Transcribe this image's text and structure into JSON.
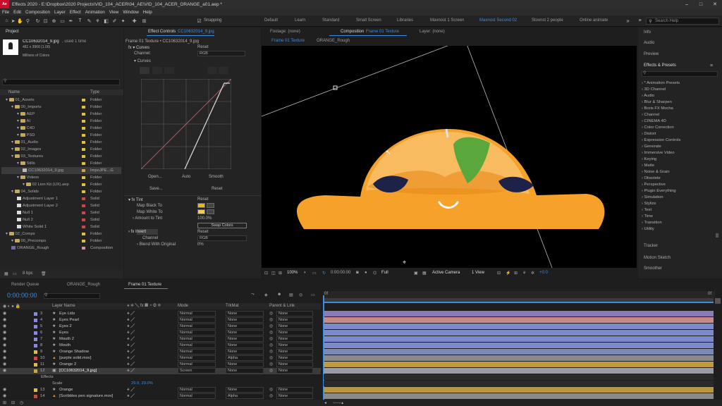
{
  "window": {
    "badge": "Ae",
    "title": "Effects 2020 - E:\\Dropbox\\2020 Projects\\VID_104_ACER\\04_AE\\VID_104_ACER_ORANGE_a01.aep *",
    "controls": [
      "–",
      "□",
      "✕"
    ]
  },
  "menu": [
    "File",
    "Edit",
    "Composition",
    "Layer",
    "Effect",
    "Animation",
    "View",
    "Window",
    "Help"
  ],
  "toolbar": {
    "snapping_label": "Snapping",
    "workspaces": [
      "Default",
      "Learn",
      "Standard",
      "Small Screen",
      "Libraries",
      "Maxnost 1 Screen",
      "Maxnost Second 02",
      "Stoxnst 2 people",
      "Online animate"
    ],
    "active_workspace_index": 6,
    "search_placeholder": "Search Help"
  },
  "project": {
    "tab": "Project",
    "item_name": "CC10632014_9.jpg",
    "item_used": ", used 1 time",
    "item_size": "481 x 3968 (1.00)",
    "item_colors": "Millions of Colors",
    "col_name": "Name",
    "col_type": "Type",
    "bpc": "8 bpc",
    "rows": [
      {
        "name": "01_Assets",
        "type": "Folder",
        "kind": "folder",
        "indent": 0,
        "swatch": "#d9c04a"
      },
      {
        "name": "00_Imports",
        "type": "Folder",
        "kind": "folder",
        "indent": 1,
        "swatch": "#d9c04a"
      },
      {
        "name": "AEP",
        "type": "Folder",
        "kind": "folder",
        "indent": 2,
        "swatch": "#d9c04a"
      },
      {
        "name": "AI",
        "type": "Folder",
        "kind": "folder",
        "indent": 2,
        "swatch": "#d9c04a"
      },
      {
        "name": "C4D",
        "type": "Folder",
        "kind": "folder",
        "indent": 2,
        "swatch": "#d9c04a"
      },
      {
        "name": "PSD",
        "type": "Folder",
        "kind": "folder",
        "indent": 2,
        "swatch": "#d9c04a"
      },
      {
        "name": "01_Audio",
        "type": "Folder",
        "kind": "folder",
        "indent": 1,
        "swatch": "#d9c04a"
      },
      {
        "name": "02_Images",
        "type": "Folder",
        "kind": "folder",
        "indent": 1,
        "swatch": "#d9c04a"
      },
      {
        "name": "03_Textures",
        "type": "Folder",
        "kind": "folder",
        "indent": 1,
        "swatch": "#d9c04a"
      },
      {
        "name": "Stills",
        "type": "Folder",
        "kind": "folder",
        "indent": 2,
        "swatch": "#d9c04a"
      },
      {
        "name": "CC10632014_9.jpg",
        "type": "ImpoJPE...G",
        "kind": "image",
        "indent": 3,
        "swatch": "#c8a35a",
        "selected": true
      },
      {
        "name": "Videos",
        "type": "Folder",
        "kind": "folder",
        "indent": 2,
        "swatch": "#d9c04a"
      },
      {
        "name": "02 Lion Kit (UX).aep",
        "type": "Folder",
        "kind": "folder",
        "indent": 3,
        "swatch": "#d9c04a"
      },
      {
        "name": "04_Solids",
        "type": "Folder",
        "kind": "folder",
        "indent": 1,
        "swatch": "#d9c04a"
      },
      {
        "name": "Adjustment Layer 1",
        "type": "Solid",
        "kind": "solid",
        "indent": 2,
        "swatch": "#c14a4a"
      },
      {
        "name": "Adjustment Layer 2",
        "type": "Solid",
        "kind": "solid",
        "indent": 2,
        "swatch": "#c14a4a"
      },
      {
        "name": "Null 1",
        "type": "Solid",
        "kind": "solid",
        "indent": 2,
        "swatch": "#c14a4a"
      },
      {
        "name": "Null 2",
        "type": "Solid",
        "kind": "solid",
        "indent": 2,
        "swatch": "#c14a4a"
      },
      {
        "name": "White Solid 1",
        "type": "Solid",
        "kind": "solid",
        "indent": 2,
        "swatch": "#c14a4a"
      },
      {
        "name": "02_Comps",
        "type": "Folder",
        "kind": "folder",
        "indent": 0,
        "swatch": "#d9c04a"
      },
      {
        "name": "00_Precomps",
        "type": "Folder",
        "kind": "folder",
        "indent": 1,
        "swatch": "#d9c04a"
      },
      {
        "name": "ORANGE_Rough",
        "type": "Composition",
        "kind": "comp",
        "indent": 1,
        "swatch": "#c79a9a"
      }
    ]
  },
  "effect_controls": {
    "tab": "Effect Controls",
    "tab_layer": "CC10632014_9.jpg",
    "header": "Frame 01 Texture • CC10632014_9.jpg",
    "curves_label": "Curves",
    "reset": "Reset",
    "channel_label": "Channel:",
    "channel_value": "RGB",
    "curves_sub": "Curves",
    "buttons": [
      "Open...",
      "Auto",
      "Smooth",
      "Save...",
      "Reset"
    ],
    "tint_label": "Tint",
    "map_black": "Map Black To",
    "map_white": "Map White To",
    "amount": "Amount to Tint",
    "amount_value": "100.0%",
    "swap_colors": "Swap Colors",
    "invert_label": "Invert",
    "invert_channel": "Channel",
    "invert_channel_value": "RGB",
    "blend": "Blend With Original",
    "blend_value": "0%"
  },
  "composition": {
    "tabs": [
      "Footage: (none)",
      "Composition",
      "Layer: (none)"
    ],
    "comp_name": "Frame 01 Texture",
    "sub_tabs": [
      "Frame 01 Texture",
      "ORANGE_Rough"
    ],
    "zoom": "100%",
    "timecode": "0:00:00:00",
    "resolution": "Full",
    "camera": "Active Camera",
    "views": "1 View",
    "exposure": "+0.0"
  },
  "right_panels": {
    "info": "Info",
    "audio": "Audio",
    "preview": "Preview",
    "effects_presets": "Effects & Presets",
    "effects": [
      "* Animation Presets",
      "3D Channel",
      "Audio",
      "Blur & Sharpen",
      "Boris FX Mocha",
      "Channel",
      "CINEMA 4D",
      "Color Correction",
      "Distort",
      "Expression Controls",
      "Generate",
      "Immersive Video",
      "Keying",
      "Matte",
      "Noise & Grain",
      "Obsolete",
      "Perspective",
      "Plugin Everything",
      "Simulation",
      "Stylize",
      "Text",
      "Time",
      "Transition",
      "Utility"
    ],
    "tracker": "Tracker",
    "motion_sketch": "Motion Sketch",
    "smoother": "Smoother"
  },
  "timeline": {
    "tabs": [
      "Render Queue",
      "ORANGE_Rough",
      "Frame 01 Texture"
    ],
    "timecode": "0:00:00:00",
    "col_layer_name": "Layer Name",
    "col_mode": "Mode",
    "col_trkmat": "TrkMat",
    "col_parent": "Parent & Link",
    "layers": [
      {
        "num": "3",
        "name": "Eye Lids",
        "mode": "Normal",
        "trk": "None",
        "parent": "None",
        "label": "#8a8ad8",
        "bar": "#8c7ab6",
        "type": "star"
      },
      {
        "num": "4",
        "name": "Eyes Pearl",
        "mode": "Normal",
        "trk": "None",
        "parent": "None",
        "label": "#8a8ad8",
        "bar": "#c78a8a",
        "type": "star"
      },
      {
        "num": "5",
        "name": "Eyes 2",
        "mode": "Normal",
        "trk": "None",
        "parent": "None",
        "label": "#8a8ad8",
        "bar": "#7c8ac9",
        "type": "star"
      },
      {
        "num": "6",
        "name": "Eyes",
        "mode": "Normal",
        "trk": "None",
        "parent": "None",
        "label": "#8a8ad8",
        "bar": "#7c8ac9",
        "type": "star"
      },
      {
        "num": "7",
        "name": "Mouth 2",
        "mode": "Normal",
        "trk": "None",
        "parent": "None",
        "label": "#8a8ad8",
        "bar": "#7c8ac9",
        "type": "star"
      },
      {
        "num": "8",
        "name": "Mouth",
        "mode": "Normal",
        "trk": "None",
        "parent": "None",
        "label": "#8a8ad8",
        "bar": "#7c8ac9",
        "type": "star"
      },
      {
        "num": "9",
        "name": "Orange Shadow",
        "mode": "Normal",
        "trk": "None",
        "parent": "None",
        "label": "#d9c04a",
        "bar": "#7a8ab8",
        "type": "star"
      },
      {
        "num": "10",
        "name": "[purple solid.mov]",
        "mode": "Normal",
        "trk": "Alpha",
        "parent": "None",
        "label": "#c14a4a",
        "bar": "#8a8a8a",
        "type": "solid"
      },
      {
        "num": "11",
        "name": "Orange 2",
        "mode": "Normal",
        "trk": "None",
        "parent": "None",
        "label": "#d9c04a",
        "bar": "#c09a40",
        "type": "star"
      },
      {
        "num": "12",
        "name": "[CC10632014_9.jpg]",
        "mode": "Screen",
        "trk": "None",
        "parent": "None",
        "label": "#c8a35a",
        "bar": "#9a9aa8",
        "type": "image",
        "selected": true
      },
      {
        "num": "13",
        "name": "Orange",
        "mode": "Normal",
        "trk": "None",
        "parent": "None",
        "label": "#d9c04a",
        "bar": "#b8963c",
        "type": "star"
      },
      {
        "num": "14",
        "name": "[Scribbles pen signature.mov]",
        "mode": "Normal",
        "trk": "Alpha",
        "parent": "None",
        "label": "#c14a4a",
        "bar": "#8a8a8a",
        "type": "solid"
      }
    ],
    "effects_row": "Effects",
    "scale_row": "Scale",
    "scale_value": "29.0, 29.0%",
    "frame_start": "0f",
    "frame_end": "0f"
  },
  "colors": {
    "accent": "#3a8ee6",
    "orange_body": "#f6a22a",
    "leaf": "#5aa83c"
  }
}
